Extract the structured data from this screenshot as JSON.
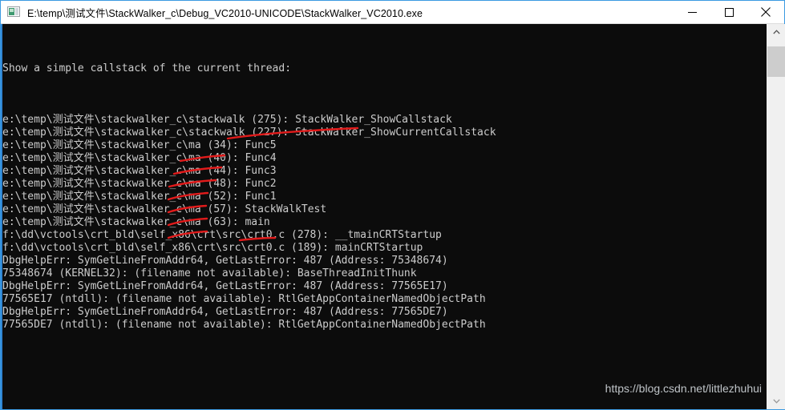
{
  "window": {
    "title": "E:\\temp\\测试文件\\StackWalker_c\\Debug_VC2010-UNICODE\\StackWalker_VC2010.exe",
    "icon": "console-app-icon",
    "minimize_label": "Minimize",
    "maximize_label": "Maximize",
    "close_label": "Close",
    "accent_color": "#3b9ae1",
    "console_bg": "#0c0c0c",
    "console_fg": "#cccccc",
    "annotation_color": "#e21b1b"
  },
  "console": {
    "lines": [
      "",
      "",
      "",
      "Show a simple callstack of the current thread:",
      "",
      "",
      "",
      "e:\\temp\\测试文件\\stackwalker_c\\stackwalk (275): StackWalker_ShowCallstack",
      "e:\\temp\\测试文件\\stackwalker_c\\stackwalk (227): StackWalker_ShowCurrentCallstack",
      "e:\\temp\\测试文件\\stackwalker_c\\ma (34): Func5",
      "e:\\temp\\测试文件\\stackwalker_c\\ma (40): Func4",
      "e:\\temp\\测试文件\\stackwalker_c\\ma (44): Func3",
      "e:\\temp\\测试文件\\stackwalker_c\\ma (48): Func2",
      "e:\\temp\\测试文件\\stackwalker_c\\ma (52): Func1",
      "e:\\temp\\测试文件\\stackwalker_c\\ma (57): StackWalkTest",
      "e:\\temp\\测试文件\\stackwalker_c\\ma (63): main",
      "f:\\dd\\vctools\\crt_bld\\self_x86\\crt\\src\\crt0.c (278): __tmainCRTStartup",
      "f:\\dd\\vctools\\crt_bld\\self_x86\\crt\\src\\crt0.c (189): mainCRTStartup",
      "DbgHelpErr: SymGetLineFromAddr64, GetLastError: 487 (Address: 75348674)",
      "75348674 (KERNEL32): (filename not available): BaseThreadInitThunk",
      "DbgHelpErr: SymGetLineFromAddr64, GetLastError: 487 (Address: 77565E17)",
      "77565E17 (ntdll): (filename not available): RtlGetAppContainerNamedObjectPath",
      "DbgHelpErr: SymGetLineFromAddr64, GetLastError: 487 (Address: 77565DE7)",
      "77565DE7 (ntdll): (filename not available): RtlGetAppContainerNamedObjectPath"
    ]
  },
  "annotations": {
    "color": "#e21b1b",
    "strokes": [
      "M 283,143 C 330,136 400,132 445,130",
      "M 224,171 C 245,167 264,165 279,164",
      "M 216,187 C 238,182 258,180 275,179",
      "M 210,203 C 230,198 250,196 268,195",
      "M 209,219 C 225,214 243,212 258,211",
      "M 209,235 C 224,230 240,228 256,227",
      "M 209,251 C 224,246 240,244 257,243",
      "M 209,267 C 224,262 240,260 257,259",
      "M 298,270 C 316,268 330,267 342,267"
    ]
  },
  "watermark": {
    "text": "https://blog.csdn.net/littlezhuhui"
  },
  "scrollbar": {
    "up_arrow": "chevron-up-icon",
    "down_arrow": "chevron-down-icon",
    "thumb": "scroll-thumb"
  }
}
